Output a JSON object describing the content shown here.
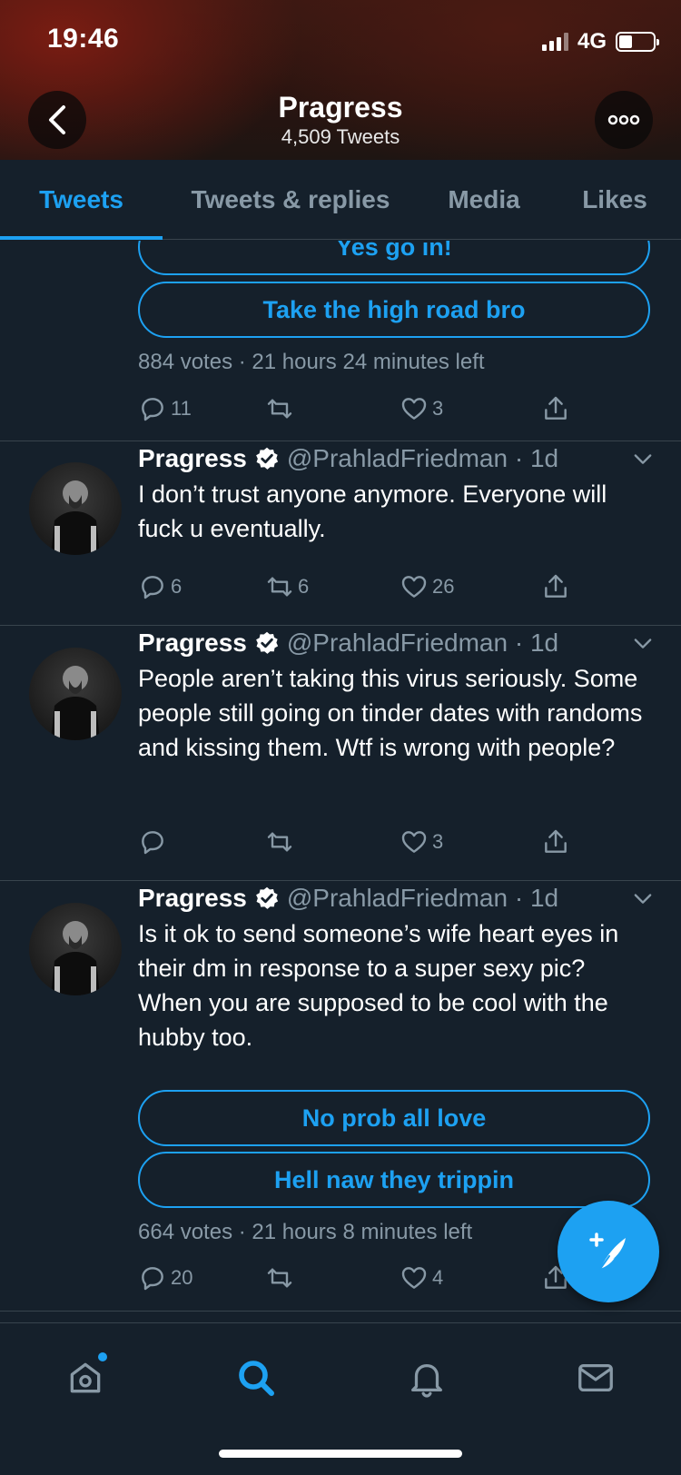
{
  "status_bar": {
    "time": "19:46",
    "network": "4G"
  },
  "header": {
    "title": "Pragress",
    "subtitle": "4,509 Tweets"
  },
  "tabs": [
    {
      "label": "Tweets",
      "active": true
    },
    {
      "label": "Tweets & replies",
      "active": false
    },
    {
      "label": "Media",
      "active": false
    },
    {
      "label": "Likes",
      "active": false
    }
  ],
  "poll_top": {
    "options": [
      "Yes go in!",
      "Take the high road bro"
    ],
    "meta": "884 votes · 21 hours 24 minutes left",
    "replies": "11",
    "retweets": "",
    "likes": "3"
  },
  "tweets": [
    {
      "name": "Pragress",
      "handle": "@PrahladFriedman · 1d",
      "text": "I don’t trust anyone anymore. Everyone will fuck u eventually.",
      "replies": "6",
      "retweets": "6",
      "likes": "26"
    },
    {
      "name": "Pragress",
      "handle": "@PrahladFriedman · 1d",
      "text": "People aren’t taking this virus seriously. Some people still going on tinder dates with randoms and kissing them. Wtf is wrong with people?",
      "replies": "",
      "retweets": "",
      "likes": "3"
    },
    {
      "name": "Pragress",
      "handle": "@PrahladFriedman · 1d",
      "text": "Is it ok to send someone’s wife heart eyes in their dm in response to a super sexy pic? When you are supposed to be cool with the hubby too.",
      "poll_options": [
        "No prob all love",
        "Hell naw they trippin"
      ],
      "poll_meta": "664 votes · 21 hours 8 minutes left",
      "replies": "20",
      "retweets": "",
      "likes": "4"
    }
  ],
  "colors": {
    "accent": "#1da1f2",
    "background": "#15202b",
    "muted": "#8899a6",
    "divider": "#38444d"
  },
  "icons": [
    "back-arrow-icon",
    "more-icon",
    "verified-icon",
    "chevron-down-icon",
    "reply-icon",
    "retweet-icon",
    "like-icon",
    "share-icon",
    "compose-icon",
    "home-icon",
    "search-icon",
    "notifications-icon",
    "messages-icon"
  ]
}
